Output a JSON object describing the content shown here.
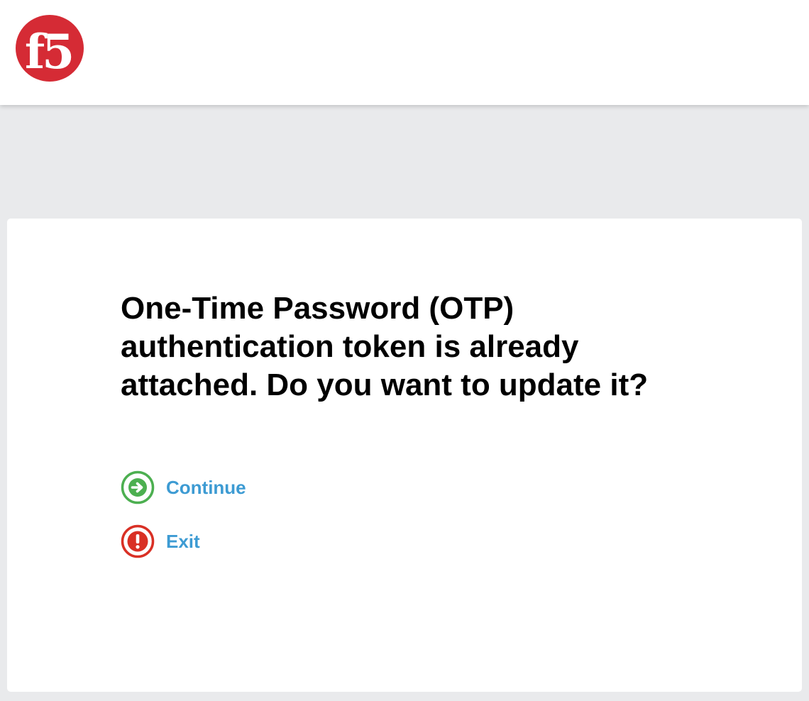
{
  "brand": {
    "logo_text": "f5",
    "logo_color": "#d52b35"
  },
  "dialog": {
    "question": "One-Time Password (OTP) authentication token is already attached. Do you want to update it?",
    "actions": [
      {
        "label": "Continue",
        "icon": "arrow-right-circle-icon",
        "color": "#4caf50"
      },
      {
        "label": "Exit",
        "icon": "exclamation-circle-icon",
        "color": "#d93025"
      }
    ]
  },
  "colors": {
    "link": "#3d9bd3",
    "page_background": "#e9eaec",
    "card_background": "#ffffff"
  }
}
